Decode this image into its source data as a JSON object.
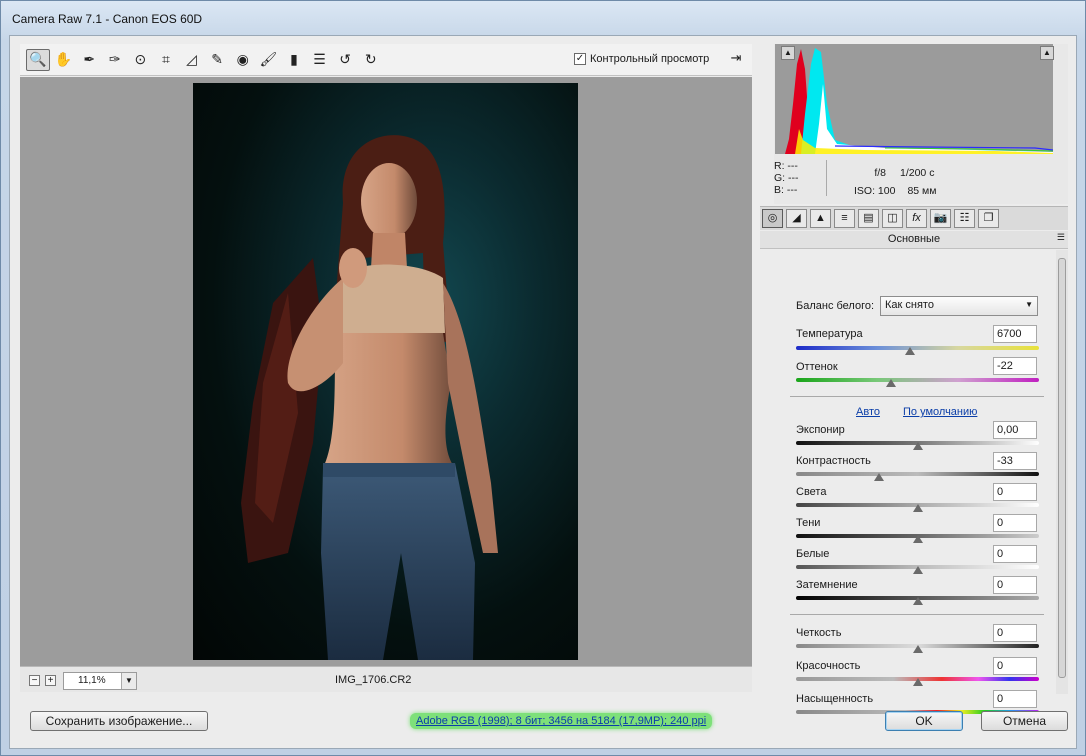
{
  "window": {
    "title": "Camera Raw 7.1  -  Canon EOS 60D"
  },
  "toolbar": {
    "tools": [
      {
        "icon": "zoom-icon",
        "glyph": "🔍"
      },
      {
        "icon": "hand-icon",
        "glyph": "✋"
      },
      {
        "icon": "white-balance-icon",
        "glyph": "✒"
      },
      {
        "icon": "color-sampler-icon",
        "glyph": "✑"
      },
      {
        "icon": "target-adjust-icon",
        "glyph": "⊙"
      },
      {
        "icon": "crop-icon",
        "glyph": "⌗"
      },
      {
        "icon": "straighten-icon",
        "glyph": "◿"
      },
      {
        "icon": "spot-removal-icon",
        "glyph": "✎"
      },
      {
        "icon": "red-eye-icon",
        "glyph": "◉"
      },
      {
        "icon": "adjustment-brush-icon",
        "glyph": "🖌"
      },
      {
        "icon": "graduated-filter-icon",
        "glyph": "▮"
      },
      {
        "icon": "preferences-icon",
        "glyph": "☰"
      },
      {
        "icon": "rotate-left-icon",
        "glyph": "↺"
      },
      {
        "icon": "rotate-right-icon",
        "glyph": "↻"
      }
    ],
    "preview_label": "Контрольный просмотр",
    "preview_checked": "✓",
    "fullscreen_glyph": "⇥"
  },
  "status": {
    "zoom_minus": "−",
    "zoom_plus": "+",
    "zoom_value": "11,1%",
    "zoom_arrow": "▼",
    "filename": "IMG_1706.CR2"
  },
  "info": {
    "r": "R:   ---",
    "g": "G:   ---",
    "b": "B:   ---",
    "aperture": "f/8",
    "shutter": "1/200 с",
    "iso": "ISO: 100",
    "focal": "85 мм"
  },
  "panel": {
    "tabs": [
      {
        "icon": "basic-tab-icon",
        "glyph": "◎"
      },
      {
        "icon": "tone-curve-tab-icon",
        "glyph": "◢"
      },
      {
        "icon": "detail-tab-icon",
        "glyph": "▲"
      },
      {
        "icon": "hsl-tab-icon",
        "glyph": "≡"
      },
      {
        "icon": "split-toning-tab-icon",
        "glyph": "▤"
      },
      {
        "icon": "lens-tab-icon",
        "glyph": "◫"
      },
      {
        "icon": "effects-tab-icon",
        "glyph": "fx"
      },
      {
        "icon": "camera-calibration-tab-icon",
        "glyph": "📷"
      },
      {
        "icon": "presets-tab-icon",
        "glyph": "☷"
      },
      {
        "icon": "snapshots-tab-icon",
        "glyph": "❐"
      }
    ],
    "title": "Основные",
    "menu_glyph": "☰",
    "white_balance_label": "Баланс белого:",
    "white_balance_value": "Как снято",
    "select_arrow": "▼",
    "auto_link": "Авто",
    "default_link": "По умолчанию",
    "sliders": {
      "temperature": {
        "label": "Температура",
        "value": "6700",
        "level": 0.47
      },
      "tint": {
        "label": "Оттенок",
        "value": "-22",
        "level": 0.39
      },
      "exposure": {
        "label": "Экспонир",
        "value": "0,00",
        "level": 0.5
      },
      "contrast": {
        "label": "Контрастность",
        "value": "-33",
        "level": 0.34
      },
      "highlights": {
        "label": "Света",
        "value": "0",
        "level": 0.5
      },
      "shadows": {
        "label": "Тени",
        "value": "0",
        "level": 0.5
      },
      "whites": {
        "label": "Белые",
        "value": "0",
        "level": 0.5
      },
      "blacks": {
        "label": "Затемнение",
        "value": "0",
        "level": 0.5
      },
      "clarity": {
        "label": "Четкость",
        "value": "0",
        "level": 0.5
      },
      "vibrance": {
        "label": "Красочность",
        "value": "0",
        "level": 0.5
      },
      "saturation": {
        "label": "Насыщенность",
        "value": "0",
        "level": 0.5
      }
    }
  },
  "bottom": {
    "save_label": "Сохранить изображение...",
    "workflow_label": "Adobe RGB (1998); 8 бит; 3456 на 5184 (17,9MP); 240 ppi",
    "ok_label": "OK",
    "cancel_label": "Отмена"
  },
  "colors": {
    "accent_link": "#0b3ea8",
    "workflow_highlight": "#7ee07a"
  }
}
